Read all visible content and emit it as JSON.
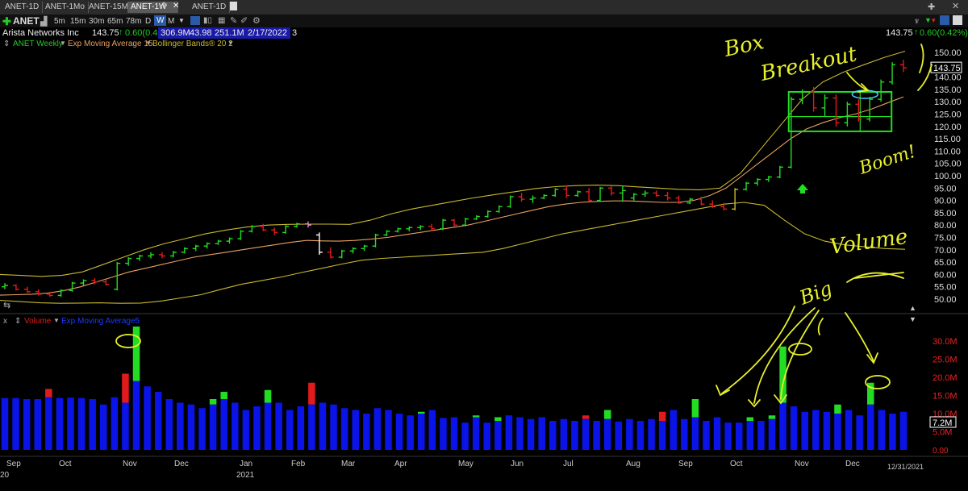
{
  "tabs": [
    "ANET-1D",
    "ANET-1Mo",
    "ANET-15M",
    "ANET-1W",
    "ANET-1D"
  ],
  "active_tab_index": 3,
  "toolbar": {
    "symbol": "ANET",
    "intervals": [
      "5m",
      "15m",
      "30m",
      "65m",
      "78m",
      "D",
      "W",
      "M"
    ],
    "active_interval": "W"
  },
  "quote": {
    "company": "Arista Networks Inc",
    "last": "143.75",
    "change": "0.60(0.42%)",
    "volume": "306.9M",
    "stat2": "43.98",
    "stat3": "251.1M",
    "date": "2/17/2022",
    "count": "3",
    "right_last": "143.75",
    "right_change": "0.60(0.42%)"
  },
  "studies": {
    "price_label": "ANET Weekly",
    "ema_label": "Exp Moving Average 15",
    "bb_label": "Bollinger Bands® 20 2",
    "volume_label": "Volume",
    "vol_ema_label": "Exp Moving Average5"
  },
  "annotations": {
    "box_breakout_1": "Box",
    "box_breakout_2": "Breakout",
    "boom": "Boom!",
    "volume": "Volume",
    "big": "Big"
  },
  "colors": {
    "up": "#22dd22",
    "down": "#e11b1b",
    "reversal": "#ffffff",
    "purple": "#e07ae0",
    "ema": "#e8a060",
    "bands": "#c8b830",
    "volume_bar": "#0a14e8",
    "annotation": "#e8f02a",
    "box": "#22dd22"
  },
  "chart_data": [
    {
      "type": "ohlc",
      "title": "ANET Weekly",
      "x_tick_labels": [
        "Sep",
        "Oct",
        "Nov",
        "Dec",
        "Jan",
        "Feb",
        "Mar",
        "Apr",
        "May",
        "Jun",
        "Jul",
        "Aug",
        "Sep",
        "Oct",
        "Nov",
        "Dec"
      ],
      "x_year_labels": [
        "20",
        "2021"
      ],
      "y_tick_labels": [
        "50.00",
        "55.00",
        "60.00",
        "65.00",
        "70.00",
        "75.00",
        "80.00",
        "85.00",
        "90.00",
        "95.00",
        "100.00",
        "105.00",
        "110.00",
        "115.00",
        "120.00",
        "125.00",
        "130.00",
        "135.00",
        "140.00",
        "145.00",
        "150.00"
      ],
      "ylim": [
        47,
        152
      ],
      "last_price_label": "143.75",
      "series": [
        {
          "name": "ANET Weekly",
          "values": [
            [
              55,
              56.5,
              54,
              55.5
            ],
            [
              55.5,
              56,
              53.5,
              54
            ],
            [
              54,
              55,
              52.5,
              53
            ],
            [
              53,
              54,
              51.5,
              52
            ],
            [
              52,
              53,
              51,
              51.5
            ],
            [
              51.5,
              54,
              51,
              53.5
            ],
            [
              53.5,
              57,
              53,
              56.5
            ],
            [
              56.5,
              58,
              55.5,
              57.5
            ],
            [
              57.5,
              58.5,
              56,
              57
            ],
            [
              57,
              58,
              55.5,
              56
            ],
            [
              54,
              65,
              53.5,
              64.5
            ],
            [
              64.5,
              67,
              63.5,
              66.5
            ],
            [
              66.5,
              68,
              65.5,
              67.5
            ],
            [
              67.5,
              69,
              66.5,
              68
            ],
            [
              68,
              69,
              66.5,
              67.5
            ],
            [
              67.5,
              69.5,
              67,
              69
            ],
            [
              69,
              71,
              68.5,
              70.5
            ],
            [
              70.5,
              72,
              69.5,
              71.5
            ],
            [
              71.5,
              73,
              70.5,
              72.5
            ],
            [
              72.5,
              74,
              72,
              73.5
            ],
            [
              73.5,
              75,
              72.5,
              74.5
            ],
            [
              74.5,
              78,
              74,
              77.5
            ],
            [
              77.5,
              80,
              77,
              79.5
            ],
            [
              79.5,
              80.5,
              77.5,
              78
            ],
            [
              78,
              79,
              76,
              77
            ],
            [
              77,
              80,
              76.5,
              79.5
            ],
            [
              79.5,
              81,
              79,
              80.5
            ],
            [
              80.5,
              81.5,
              79,
              80
            ],
            [
              76,
              77,
              68,
              69
            ],
            [
              69,
              71,
              66.5,
              67
            ],
            [
              67,
              70,
              66.5,
              69.5
            ],
            [
              69.5,
              71,
              68.5,
              70.5
            ],
            [
              70.5,
              72,
              69.5,
              71.5
            ],
            [
              71.5,
              76.5,
              71,
              76
            ],
            [
              76,
              78,
              75.5,
              77.5
            ],
            [
              77.5,
              79,
              77,
              78.5
            ],
            [
              78.5,
              79.5,
              77.5,
              79
            ],
            [
              79,
              80,
              78,
              79.5
            ],
            [
              79.5,
              80.5,
              77.5,
              78.5
            ],
            [
              78.5,
              82.5,
              78,
              82
            ],
            [
              82,
              82.5,
              79.5,
              80
            ],
            [
              80,
              83,
              79.5,
              82.5
            ],
            [
              82.5,
              84,
              82,
              83.5
            ],
            [
              83.5,
              86,
              83,
              85.5
            ],
            [
              85.5,
              88,
              85,
              87.5
            ],
            [
              87.5,
              92,
              87,
              91.5
            ],
            [
              91.5,
              93,
              89.5,
              90.5
            ],
            [
              90.5,
              92,
              89,
              91
            ],
            [
              91,
              92.5,
              90.5,
              92
            ],
            [
              92,
              95,
              91.5,
              94.5
            ],
            [
              94.5,
              96,
              91,
              92
            ],
            [
              92,
              94,
              91.5,
              93.5
            ],
            [
              93.5,
              95,
              89.5,
              90
            ],
            [
              90,
              95.5,
              89.5,
              95
            ],
            [
              95,
              96,
              92,
              93
            ],
            [
              93,
              96,
              89.5,
              94
            ],
            [
              91,
              93,
              90,
              92.5
            ],
            [
              92.5,
              94,
              91.5,
              93
            ],
            [
              93,
              94,
              91.5,
              92
            ],
            [
              92,
              93.5,
              90,
              91
            ],
            [
              91,
              92,
              88.5,
              89
            ],
            [
              89,
              91,
              88.5,
              90.5
            ],
            [
              90.5,
              91.5,
              88,
              88.5
            ],
            [
              88.5,
              90,
              87,
              87.5
            ],
            [
              87.5,
              89,
              86,
              86.5
            ],
            [
              86.5,
              95,
              86,
              94.5
            ],
            [
              94.5,
              97.5,
              94,
              97
            ],
            [
              97,
              99,
              96,
              98.5
            ],
            [
              98.5,
              100,
              97.5,
              99.5
            ],
            [
              99.5,
              104,
              99,
              103.5
            ],
            [
              103.5,
              132,
              103,
              131
            ],
            [
              131,
              135,
              129,
              134
            ],
            [
              134,
              136,
              126,
              127.5
            ],
            [
              127.5,
              133,
              124,
              131.5
            ],
            [
              131.5,
              133,
              120,
              121.5
            ],
            [
              121.5,
              130,
              120,
              129
            ],
            [
              129,
              131,
              122,
              123
            ],
            [
              123,
              132,
              122,
              131
            ],
            [
              131,
              139,
              130,
              138
            ],
            [
              138,
              146,
              137,
              145
            ],
            [
              145,
              147,
              142,
              143.75
            ]
          ]
        },
        {
          "name": "Exp Moving Average 15",
          "values": [
            51.6,
            51.8,
            52.0,
            52.5,
            53.5,
            55.0,
            57.0,
            59.0,
            61.0,
            62.5,
            64.0,
            65.5,
            67.0,
            68.0,
            69.0,
            70.0,
            71.0,
            72.0,
            73.0,
            73.8,
            73.6,
            73.5,
            73.8,
            74.3,
            75.0,
            76.0,
            77.0,
            78.0,
            79.0,
            80.0,
            81.5,
            83.0,
            84.5,
            86.0,
            87.5,
            88.5,
            89.2,
            89.6,
            89.8,
            89.8,
            89.5,
            89.2,
            89.2,
            90.0,
            92.0,
            95.0,
            100.0,
            105.0,
            110.0,
            115.0,
            119.0,
            121.5,
            123.5,
            125.0,
            127.0,
            129.5,
            132.0
          ]
        },
        {
          "name": "Bollinger upper",
          "values": [
            60.0,
            59.6,
            59.2,
            59.6,
            61.0,
            64.0,
            67.0,
            70.0,
            72.5,
            74.5,
            76.5,
            78.0,
            79.2,
            80.0,
            80.3,
            80.4,
            80.4,
            80.3,
            82.0,
            84.5,
            86.5,
            88.0,
            89.5,
            91.0,
            92.3,
            93.5,
            94.8,
            95.6,
            96.0,
            96.2,
            96.0,
            95.5,
            95.0,
            94.5,
            94.3,
            95.0,
            101.0,
            111.0,
            121.0,
            131.0,
            138.0,
            142.0,
            145.0,
            148.0,
            150.5
          ]
        },
        {
          "name": "Bollinger lower",
          "values": [
            49.5,
            49.0,
            48.5,
            48.3,
            48.4,
            48.5,
            48.3,
            48.4,
            49.2,
            50.5,
            51.8,
            54.0,
            56.0,
            57.5,
            59.0,
            60.8,
            62.5,
            64.2,
            65.8,
            66.5,
            67.0,
            67.5,
            68.0,
            68.5,
            69.0,
            70.5,
            72.5,
            74.5,
            76.5,
            78.0,
            79.5,
            81.0,
            82.5,
            84.0,
            85.5,
            87.0,
            88.5,
            89.2,
            88.0,
            82.0,
            76.5,
            73.5,
            72.0,
            71.2,
            70.5,
            70.2
          ]
        }
      ]
    },
    {
      "type": "bar",
      "title": "Volume",
      "y_tick_labels": [
        "5.0M",
        "10.0M",
        "15.0M",
        "20.0M",
        "25.0M",
        "30.0M"
      ],
      "ylim": [
        0,
        35
      ],
      "last_value_label": "7.2M",
      "series": [
        {
          "name": "Volume",
          "values": [
            14.5,
            14.3,
            14.2,
            14.0,
            16.8,
            14.3,
            14.4,
            14.3,
            14.0,
            12.5,
            14.5,
            21.0,
            34.0,
            17.5,
            16.0,
            14.0,
            13.0,
            12.5,
            11.5,
            14.0,
            16.0,
            13.0,
            11.0,
            12.0,
            16.5,
            13.0,
            11.0,
            12.0,
            18.5,
            13.0,
            12.5,
            11.5,
            11.0,
            10.0,
            11.5,
            11.0,
            10.0,
            9.5,
            10.5,
            11.0,
            8.8,
            9.0,
            7.5,
            9.5,
            7.5,
            9.0,
            9.5,
            9.0,
            8.5,
            9.0,
            8.0,
            8.5,
            8.0,
            9.5,
            8.0,
            11.0,
            7.8,
            8.5,
            8.0,
            8.5,
            10.5,
            11.0,
            8.5,
            14.0,
            8.0,
            9.0,
            7.5,
            7.5,
            9.0,
            8.0,
            9.5,
            28.5,
            12.0,
            10.5,
            11.0,
            10.5,
            12.5,
            11.0,
            9.5,
            18.5,
            11.0,
            10.0,
            10.5
          ]
        },
        {
          "name": "Exp Moving Average5",
          "values": [
            14.3,
            14.3,
            14.0,
            14.0,
            14.5,
            14.3,
            14.4,
            14.3,
            14.0,
            12.5,
            14.5,
            13.0,
            19.0,
            17.5,
            16.0,
            14.0,
            13.0,
            12.5,
            11.5,
            12.5,
            14.0,
            13.0,
            11.0,
            12.0,
            13.0,
            13.0,
            11.0,
            12.0,
            12.5,
            13.0,
            12.5,
            11.5,
            11.0,
            10.0,
            11.5,
            11.0,
            10.0,
            9.5,
            10.0,
            11.0,
            8.8,
            9.0,
            7.5,
            9.0,
            7.5,
            8.0,
            9.5,
            9.0,
            8.5,
            9.0,
            8.0,
            8.5,
            8.0,
            8.5,
            8.0,
            8.5,
            7.8,
            8.5,
            8.0,
            8.5,
            8.0,
            11.0,
            8.5,
            9.0,
            8.0,
            9.0,
            7.5,
            7.5,
            8.0,
            8.0,
            8.5,
            13.0,
            12.0,
            10.5,
            11.0,
            10.5,
            10.0,
            11.0,
            9.5,
            12.5,
            11.0,
            10.0,
            10.5
          ]
        }
      ]
    }
  ]
}
